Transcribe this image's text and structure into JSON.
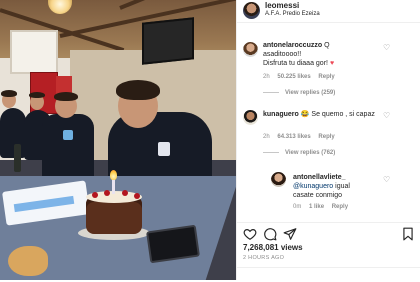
{
  "post": {
    "username": "leomessi",
    "location": "A.F.A. Predio Ezeiza"
  },
  "comments": [
    {
      "username": "antonelaroccuzzo",
      "text_lines": [
        "Q",
        "asaditoooo!!",
        "Disfruta tu diaaa gor!"
      ],
      "emoji": "♥",
      "time": "2h",
      "likes": "50.225 likes",
      "reply": "Reply",
      "view_replies": "View replies (259)"
    },
    {
      "username": "kunaguero",
      "text": "Se quemo , si capaz",
      "emoji": "😂",
      "time": "2h",
      "likes": "64.313 likes",
      "reply": "Reply",
      "view_replies": "View replies (762)"
    },
    {
      "username": "antonellavliete_",
      "mention": "@kunaguero",
      "text_lines": [
        "igual",
        "casate conmigo"
      ],
      "time": "0m",
      "likes": "1 like",
      "reply": "Reply"
    }
  ],
  "stats": {
    "views": "7,268,081 views",
    "time_ago": "2 HOURS AGO"
  },
  "icons": {
    "like": "heart-icon",
    "comment": "comment-icon",
    "share": "paper-plane-icon",
    "save": "bookmark-icon"
  },
  "colors": {
    "text": "#262626",
    "muted": "#8e8e8e",
    "mention": "#00376b",
    "heart": "#ed4956"
  }
}
